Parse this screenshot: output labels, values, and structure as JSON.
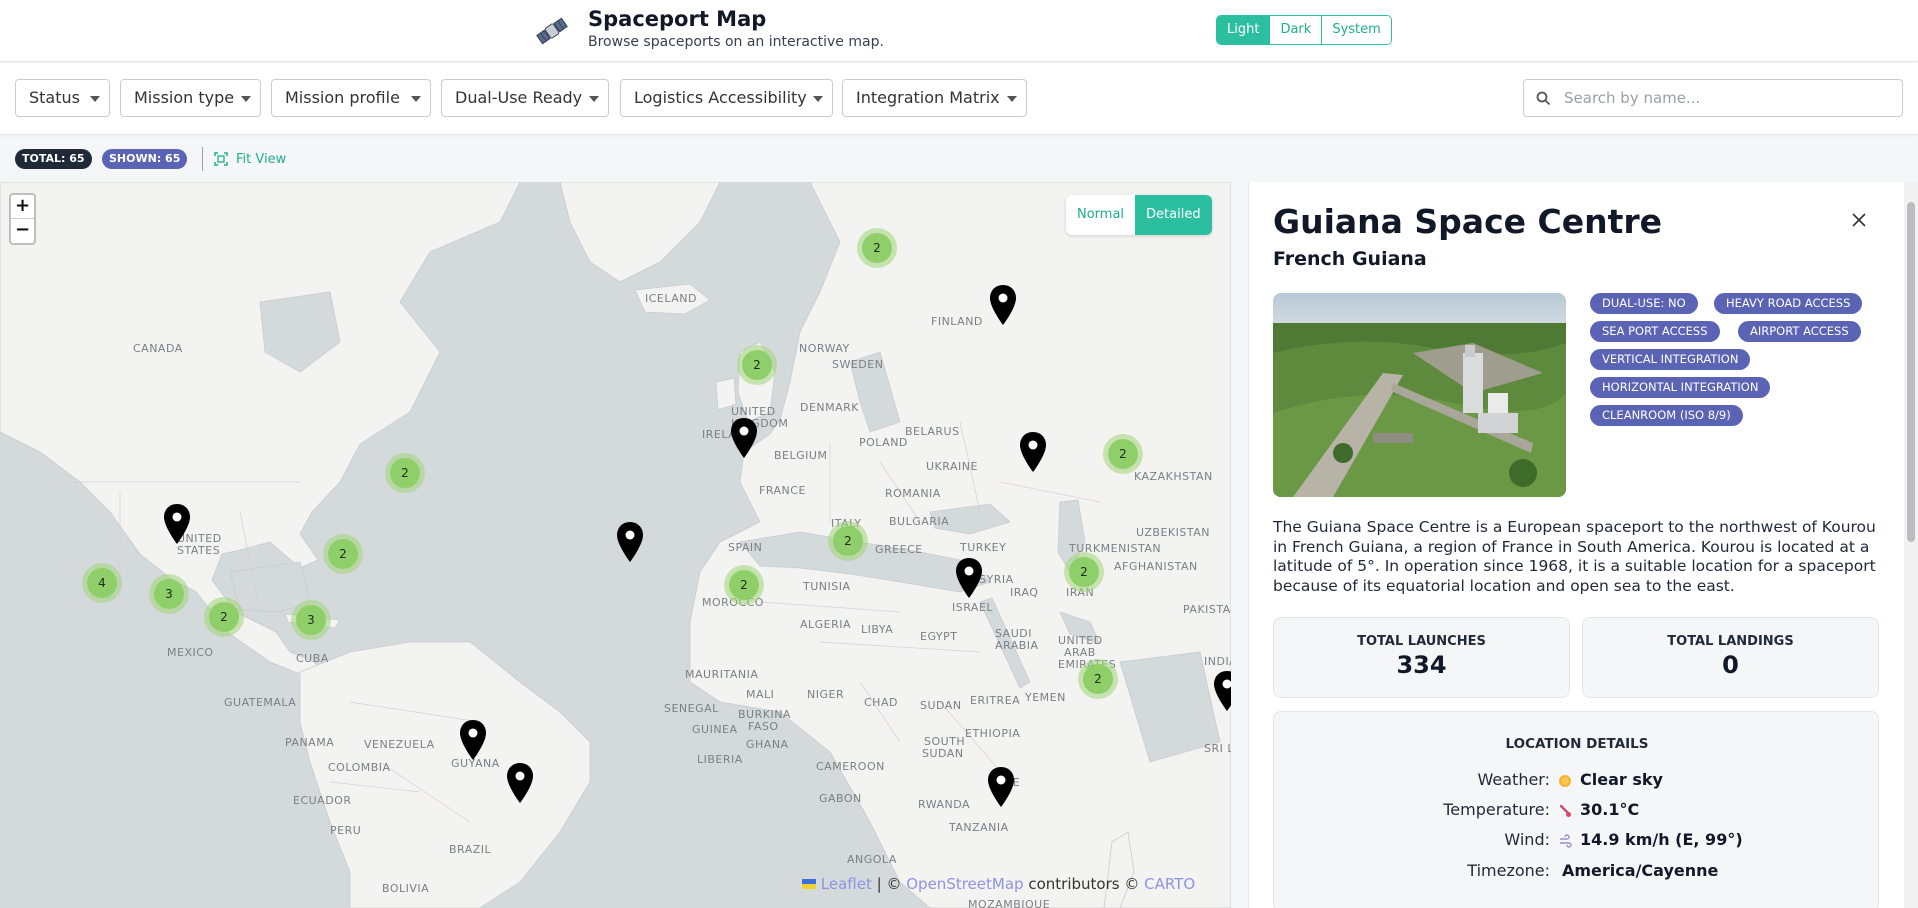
{
  "header": {
    "title": "Spaceport Map",
    "subtitle": "Browse spaceports on an interactive map.",
    "logo_icon": "satellite-icon",
    "theme_options": [
      "Light",
      "Dark",
      "System"
    ],
    "theme_selected": "Light"
  },
  "filters": {
    "status": "Status",
    "mission_type": "Mission type",
    "mission_profile": "Mission profile",
    "dual_use": "Dual-Use Ready",
    "logistics": "Logistics Accessibility",
    "integration": "Integration Matrix"
  },
  "search": {
    "placeholder": "Search by name..."
  },
  "stats": {
    "total": "TOTAL: 65",
    "shown": "SHOWN: 65",
    "fit_view": "Fit View"
  },
  "map": {
    "view_options": [
      "Normal",
      "Detailed"
    ],
    "view_selected": "Detailed",
    "zoom_in": "+",
    "zoom_out": "−",
    "labels": [
      "ICELAND",
      "CANADA",
      "FINLAND",
      "NORWAY",
      "SWEDEN",
      "UNITED",
      "KINGDOM",
      "IRELAND",
      "DENMARK",
      "BELARUS",
      "POLAND",
      "BELGIUM",
      "UKRAINE",
      "FRANCE",
      "ROMANIA",
      "ITALY",
      "BULGARIA",
      "SPAIN",
      "GREECE",
      "TURKEY",
      "UNITED",
      "STATES",
      "KAZAKHSTAN",
      "UZBEKISTAN",
      "TURKMENISTAN",
      "IRAN",
      "AFGHANISTAN",
      "PAKISTAN",
      "INDIA",
      "SRI L",
      "SYRIA",
      "IRAQ",
      "ISRAEL",
      "TUNISIA",
      "MOROCCO",
      "ALGERIA",
      "LIBYA",
      "EGYPT",
      "SAUDI",
      "ARABIA",
      "UNITED",
      "ARAB",
      "EMIRATES",
      "YEMEN",
      "MEXICO",
      "CUBA",
      "GUATEMALA",
      "PANAMA",
      "VENEZUELA",
      "COLOMBIA",
      "GUYANA",
      "ECUADOR",
      "PERU",
      "BRAZIL",
      "BOLIVIA",
      "MAURITANIA",
      "MALI",
      "BURKINA",
      "FASO",
      "SENEGAL",
      "GUINEA",
      "GHANA",
      "LIBERIA",
      "NIGER",
      "CHAD",
      "SUDAN",
      "SOUTH",
      "SUDAN",
      "ETHIOPIA",
      "ERITREA",
      "CAMEROON",
      "GABON",
      "KE",
      "RWANDA",
      "TANZANIA",
      "ANGOLA",
      "MOZAMBIQUE"
    ],
    "clusters": [
      "2",
      "2",
      "2",
      "2",
      "2",
      "2",
      "2",
      "2",
      "2",
      "4",
      "3",
      "2",
      "3",
      "2"
    ],
    "attribution": {
      "leaflet": "Leaflet",
      "sep1": "| ©",
      "osm": "OpenStreetMap",
      "contrib": "contributors ©",
      "carto": "CARTO"
    }
  },
  "detail": {
    "name": "Guiana Space Centre",
    "region": "French Guiana",
    "tags": [
      "DUAL-USE: NO",
      "HEAVY ROAD ACCESS",
      "SEA PORT ACCESS",
      "AIRPORT ACCESS",
      "VERTICAL INTEGRATION",
      "HORIZONTAL INTEGRATION",
      "CLEANROOM (ISO 8/9)"
    ],
    "description": "The Guiana Space Centre is a European spaceport to the northwest of Kourou in French Guiana, a region of France in South America. Kourou is located at a latitude of 5°. In operation since 1968, it is a suitable location for a spaceport because of its equatorial location and open sea to the east.",
    "total_launches_label": "TOTAL LAUNCHES",
    "total_launches": "334",
    "total_landings_label": "TOTAL LANDINGS",
    "total_landings": "0",
    "location_title": "LOCATION DETAILS",
    "weather_label": "Weather:",
    "weather": "Clear sky",
    "weather_icon": "sun-icon",
    "temperature_label": "Temperature:",
    "temperature": "30.1°C",
    "temperature_icon": "thermometer-icon",
    "wind_label": "Wind:",
    "wind": "14.9 km/h (E, 99°)",
    "wind_icon": "wind-icon",
    "timezone_label": "Timezone:",
    "timezone": "America/Cayenne"
  }
}
